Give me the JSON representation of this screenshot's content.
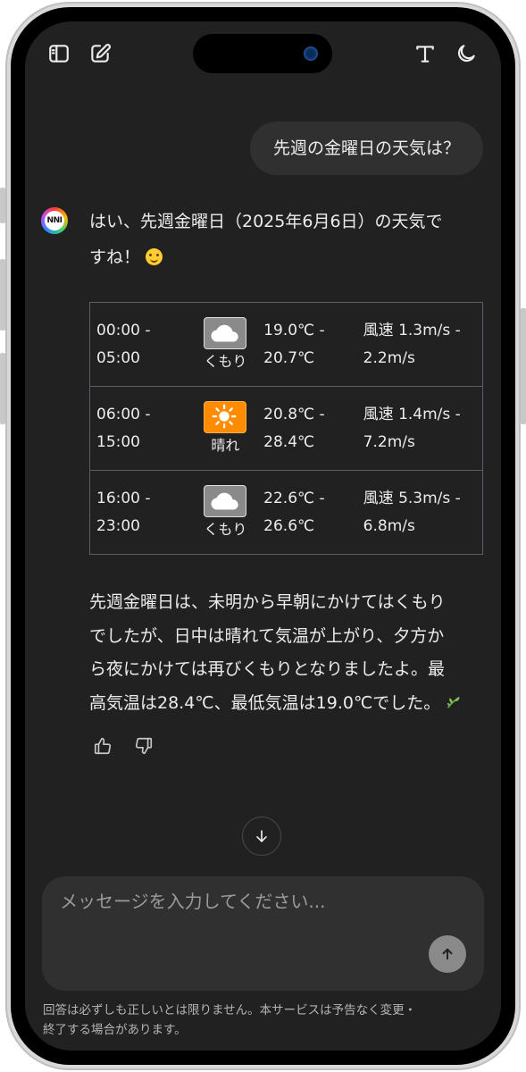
{
  "conversation": {
    "user_message": "先週の金曜日の天気は？",
    "bot_avatar_text": "NNI",
    "bot_intro_line1": "はい、先週金曜日（2025年6月6日）の天気で",
    "bot_intro_line2": "すね！",
    "weather_rows": [
      {
        "time_start": "00:00 -",
        "time_end": "05:00",
        "icon": "cloud-icon",
        "condition": "くもり",
        "temp_min": "19.0℃ -",
        "temp_max": "20.7℃",
        "wind_line1": "風速 1.3m/s -",
        "wind_line2": "2.2m/s"
      },
      {
        "time_start": "06:00 -",
        "time_end": "15:00",
        "icon": "sun-icon",
        "condition": "晴れ",
        "temp_min": "20.8℃ -",
        "temp_max": "28.4℃",
        "wind_line1": "風速 1.4m/s -",
        "wind_line2": "7.2m/s"
      },
      {
        "time_start": "16:00 -",
        "time_end": "23:00",
        "icon": "cloud-icon",
        "condition": "くもり",
        "temp_min": "22.6℃ -",
        "temp_max": "26.6℃",
        "wind_line1": "風速 5.3m/s -",
        "wind_line2": "6.8m/s"
      }
    ],
    "summary_line1": "先週金曜日は、未明から早朝にかけてはくもり",
    "summary_line2": "でしたが、日中は晴れて気温が上がり、夕方か",
    "summary_line3": "ら夜にかけては再びくもりとなりましたよ。最",
    "summary_line4": "高気温は28.4℃、最低気温は19.0℃でした。"
  },
  "composer": {
    "placeholder": "メッセージを入力してください..."
  },
  "footer": {
    "disclaimer_line1": "回答は必ずしも正しいとは限りません。本サービスは予告なく変更・",
    "disclaimer_line2": "終了する場合があります。"
  },
  "colors": {
    "screen_bg": "#212121",
    "bubble_bg": "#303030",
    "text": "#ececec",
    "sunny_bg": "#ff8c00",
    "cloudy_bg": "#8a8a8a"
  },
  "icons": {
    "top_left": [
      "sidebar-icon",
      "new-chat-icon"
    ],
    "top_right": [
      "text-format-icon",
      "moon-icon"
    ],
    "feedback": [
      "thumbs-up-icon",
      "thumbs-down-icon"
    ],
    "scroll": "arrow-down-icon",
    "send": "arrow-up-icon"
  }
}
